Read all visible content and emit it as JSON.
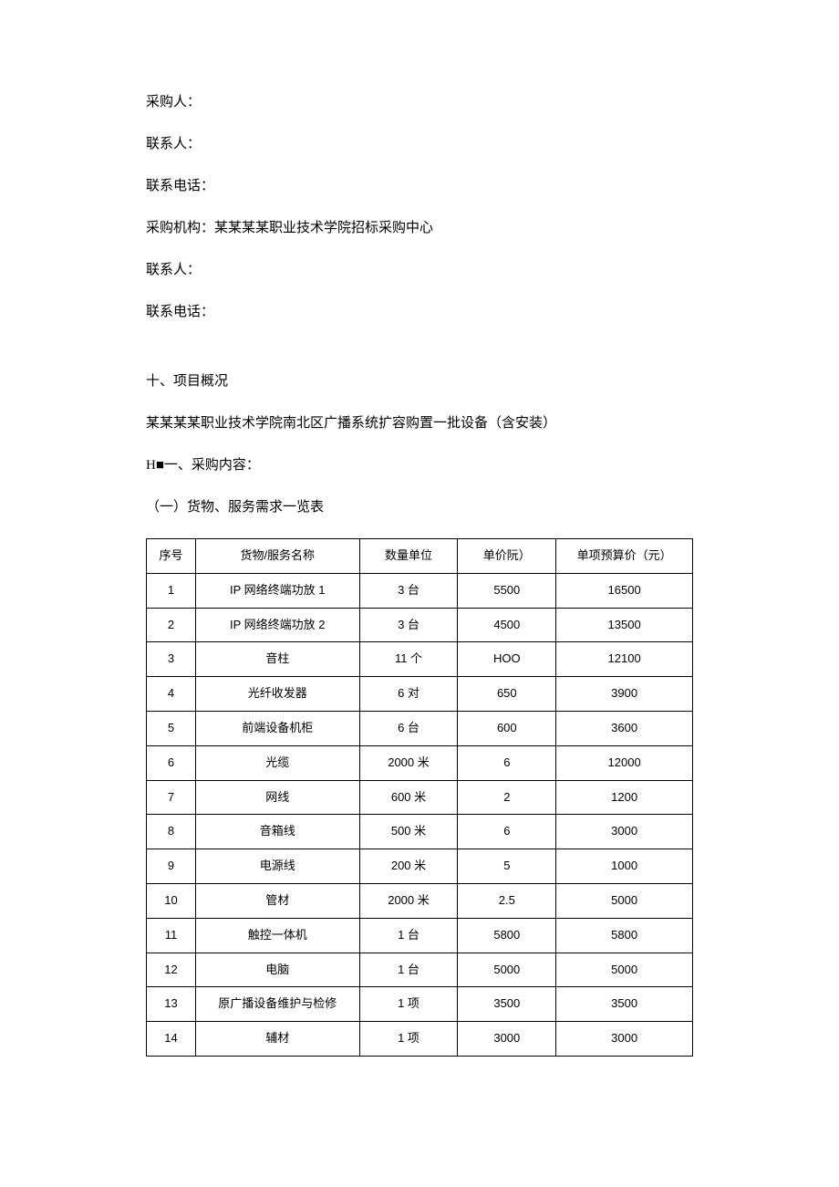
{
  "fields": {
    "purchaser_label": "采购人：",
    "contact1_label": "联系人：",
    "phone1_label": "联系电话：",
    "agency_label": "采购机构：某某某某职业技术学院招标采购中心",
    "contact2_label": "联系人：",
    "phone2_label": "联系电话："
  },
  "section10_heading": "十、项目概况",
  "project_desc": "某某某某职业技术学院南北区广播系统扩容购置一批设备（含安装）",
  "h_section_heading": "H■一、采购内容：",
  "table_intro": "（一）货物、服务需求一览表",
  "table": {
    "headers": {
      "seq": "序号",
      "name": "货物/服务名称",
      "qty": "数量单位",
      "unit_price": "单价阮）",
      "budget": "单项预算价（元）"
    },
    "rows": [
      {
        "seq": "1",
        "name": "IP 网络终端功放 1",
        "qty": "3 台",
        "unit_price": "5500",
        "budget": "16500"
      },
      {
        "seq": "2",
        "name": "IP 网络终端功放 2",
        "qty": "3 台",
        "unit_price": "4500",
        "budget": "13500"
      },
      {
        "seq": "3",
        "name": "音柱",
        "qty": "11 个",
        "unit_price": "HOO",
        "budget": "12100"
      },
      {
        "seq": "4",
        "name": "光纤收发器",
        "qty": "6 对",
        "unit_price": "650",
        "budget": "3900"
      },
      {
        "seq": "5",
        "name": "前端设备机柜",
        "qty": "6 台",
        "unit_price": "600",
        "budget": "3600"
      },
      {
        "seq": "6",
        "name": "光缆",
        "qty": "2000 米",
        "unit_price": "6",
        "budget": "12000"
      },
      {
        "seq": "7",
        "name": "网线",
        "qty": "600 米",
        "unit_price": "2",
        "budget": "1200"
      },
      {
        "seq": "8",
        "name": "音箱线",
        "qty": "500 米",
        "unit_price": "6",
        "budget": "3000"
      },
      {
        "seq": "9",
        "name": "电源线",
        "qty": "200 米",
        "unit_price": "5",
        "budget": "1000"
      },
      {
        "seq": "10",
        "name": "管材",
        "qty": "2000 米",
        "unit_price": "2.5",
        "budget": "5000"
      },
      {
        "seq": "11",
        "name": "触控一体机",
        "qty": "1 台",
        "unit_price": "5800",
        "budget": "5800"
      },
      {
        "seq": "12",
        "name": "电脑",
        "qty": "1 台",
        "unit_price": "5000",
        "budget": "5000"
      },
      {
        "seq": "13",
        "name": "原广播设备维护与检修",
        "qty": "1 项",
        "unit_price": "3500",
        "budget": "3500"
      },
      {
        "seq": "14",
        "name": "辅材",
        "qty": "1 项",
        "unit_price": "3000",
        "budget": "3000"
      }
    ]
  }
}
